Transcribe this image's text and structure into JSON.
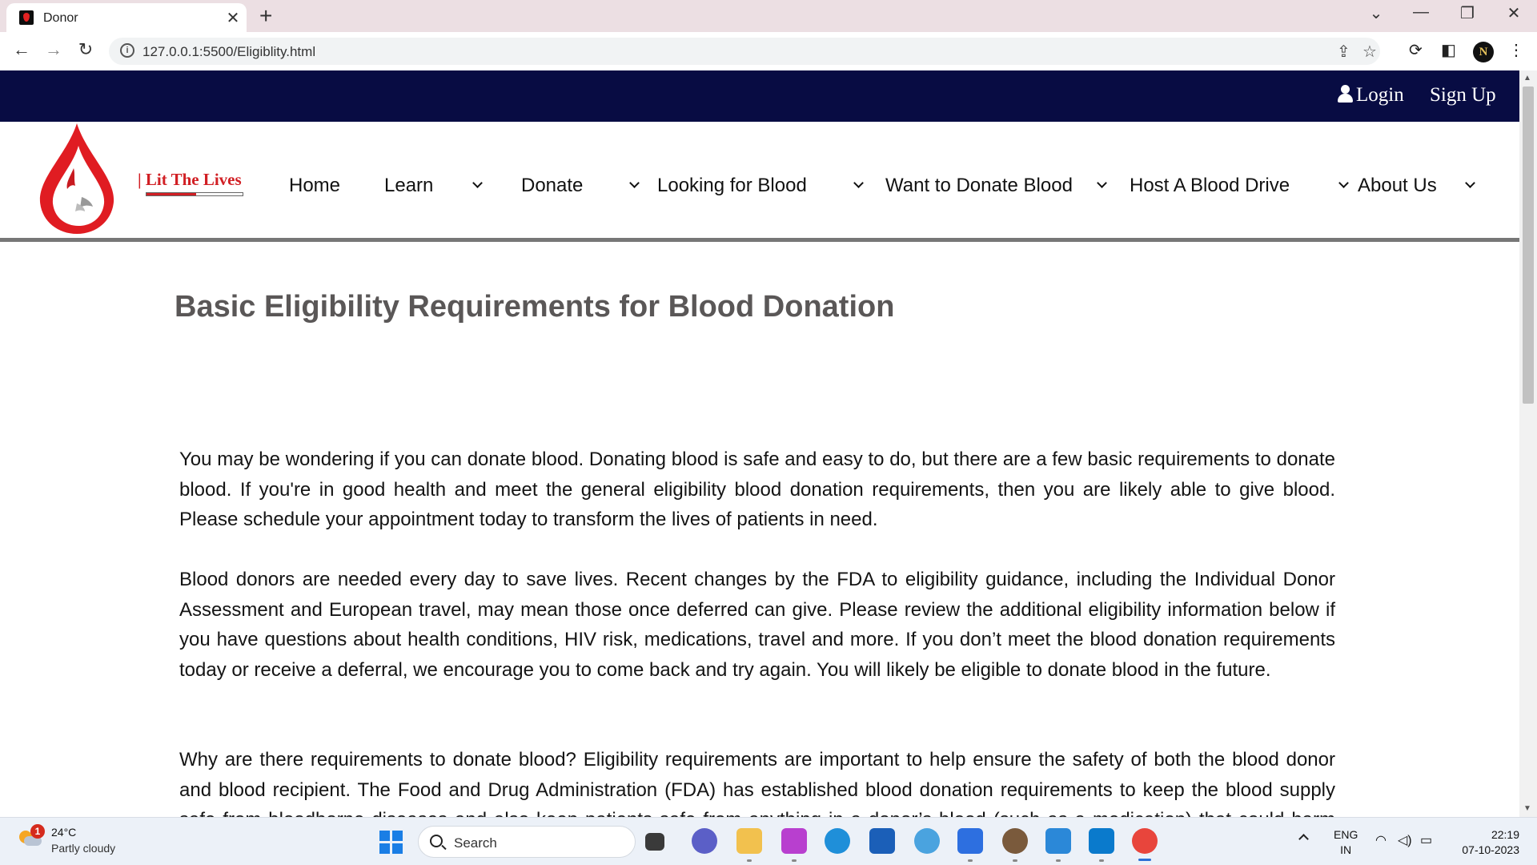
{
  "browser": {
    "tab_title": "Donor",
    "tab_close": "✕",
    "new_tab": "+",
    "url": "127.0.0.1:5500/Eligiblity.html",
    "profile_initial": "N",
    "window_controls": [
      "⌄",
      "—",
      "❐",
      "✕"
    ]
  },
  "site": {
    "topbar": {
      "login": "Login",
      "signup": "Sign Up"
    },
    "brand": "| Lit The Lives",
    "nav": [
      {
        "label": "Home",
        "dropdown": false
      },
      {
        "label": "Learn",
        "dropdown": true
      },
      {
        "label": "Donate",
        "dropdown": true
      },
      {
        "label": "Looking for Blood",
        "dropdown": true
      },
      {
        "label": "Want to Donate Blood",
        "dropdown": true
      },
      {
        "label": "Host A Blood Drive",
        "dropdown": true
      },
      {
        "label": "About Us",
        "dropdown": true
      }
    ],
    "colors": {
      "topbar": "#080c43",
      "brand_red": "#d11f24",
      "title_gray": "#5a5757"
    }
  },
  "content": {
    "title": "Basic Eligibility Requirements for Blood Donation",
    "paragraphs": [
      "You may be wondering if you can donate blood. Donating blood is safe and easy to do, but there are a few basic requirements to donate blood. If you're in good health and meet the general eligibility blood donation requirements, then you are likely able to give blood. Please schedule your appointment today to transform the lives of patients in need.",
      "Blood donors are needed every day to save lives. Recent changes by the FDA to eligibility guidance, including the Individual Donor Assessment and European travel, may mean those once deferred can give. Please review the additional eligibility information below if you have questions about health conditions, HIV risk, medications, travel and more. If you don’t meet the blood donation requirements today or receive a deferral, we encourage you to come back and try again. You will likely be eligible to donate blood in the future.",
      "Why are there requirements to donate blood? Eligibility requirements are important to help ensure the safety of both the blood donor and blood recipient. The Food and Drug Administration (FDA) has established blood donation requirements to keep the blood supply safe from bloodborne diseases and also keep patients safe from anything in a donor’s blood (such as a medication) that could harm them. These blood donation requirements also protect donors by making sure they are physically able to safely donate."
    ]
  },
  "taskbar": {
    "weather": {
      "temp": "24°C",
      "desc": "Partly cloudy",
      "badge": "1"
    },
    "search_label": "Search",
    "lang": {
      "line1": "ENG",
      "line2": "IN"
    },
    "clock": {
      "time": "22:19",
      "date": "07-10-2023"
    }
  }
}
